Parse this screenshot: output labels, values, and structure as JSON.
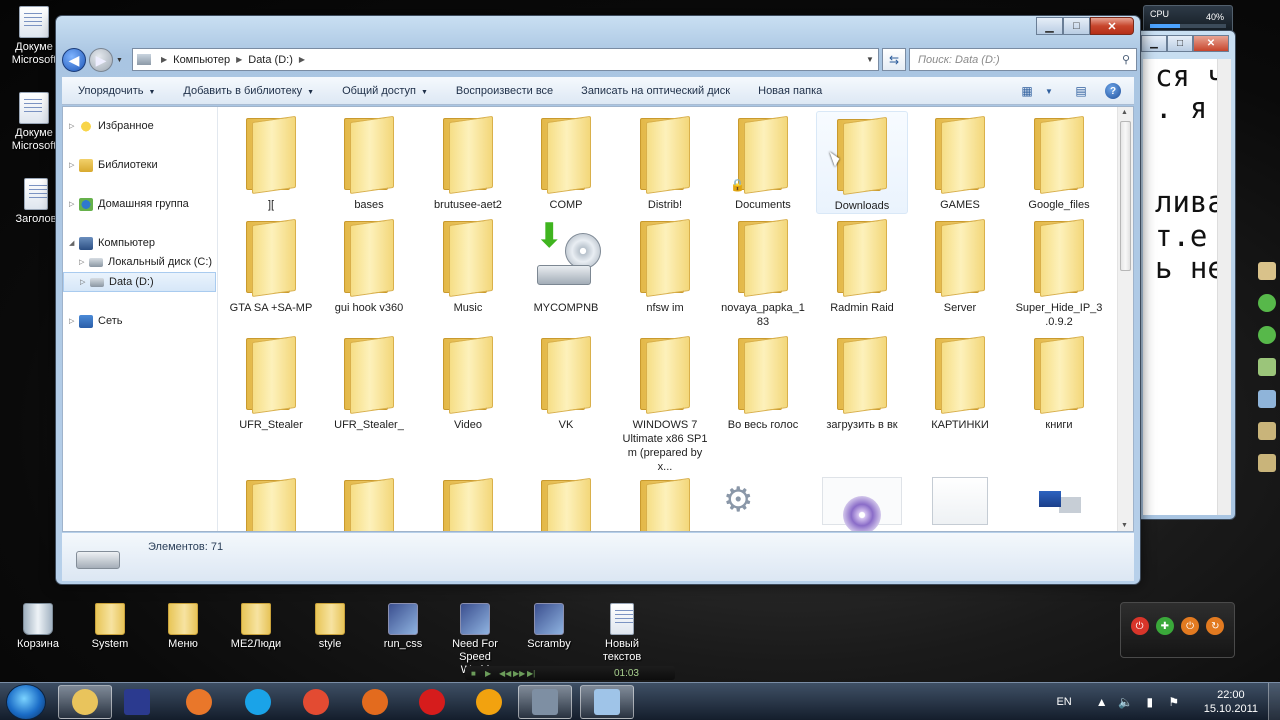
{
  "desktop": {
    "icons_left": [
      {
        "label": "Докуме Microsoft",
        "icon": "word-doc-icon"
      },
      {
        "label": "Докуме Microsoft",
        "icon": "word-doc-icon"
      },
      {
        "label": "Заголов",
        "icon": "text-doc-icon"
      }
    ],
    "icons_bottom": [
      {
        "label": "Корзина",
        "icon": "recycle-bin-icon"
      },
      {
        "label": "System",
        "icon": "folder-icon"
      },
      {
        "label": "Меню",
        "icon": "folder-icon"
      },
      {
        "label": "ME2Люди",
        "icon": "folder-icon"
      },
      {
        "label": "style",
        "icon": "folder-icon"
      },
      {
        "label": "run_css",
        "icon": "cs-shortcut-icon"
      },
      {
        "label": "Need For Speed World",
        "icon": "nfs-shortcut-icon"
      },
      {
        "label": "Scramby",
        "icon": "scramby-shortcut-icon"
      },
      {
        "label": "Новый текстов",
        "icon": "text-doc-icon"
      }
    ]
  },
  "cpu_gadget": {
    "label": "CPU",
    "value": "40%",
    "percent": 40
  },
  "explorer": {
    "address": {
      "segments": [
        "Компьютер",
        "Data (D:)"
      ]
    },
    "search": {
      "placeholder": "Поиск: Data (D:)"
    },
    "toolbar": [
      {
        "label": "Упорядочить",
        "dropdown": true
      },
      {
        "label": "Добавить в библиотеку",
        "dropdown": true
      },
      {
        "label": "Общий доступ",
        "dropdown": true
      },
      {
        "label": "Воспроизвести все",
        "dropdown": false
      },
      {
        "label": "Записать на оптический диск",
        "dropdown": false
      },
      {
        "label": "Новая папка",
        "dropdown": false
      }
    ],
    "nav": [
      {
        "label": "Избранное",
        "icon": "star-icon"
      },
      {
        "label": "Библиотеки",
        "icon": "library-icon"
      },
      {
        "label": "Домашняя группа",
        "icon": "homegroup-icon"
      },
      {
        "label": "Компьютер",
        "icon": "computer-icon"
      },
      {
        "label": "Локальный диск (C:)",
        "icon": "drive-icon"
      },
      {
        "label": "Data (D:)",
        "icon": "drive-icon",
        "selected": true
      },
      {
        "label": "Сеть",
        "icon": "network-icon"
      }
    ],
    "files": [
      {
        "name": "][",
        "type": "folder"
      },
      {
        "name": "bases",
        "type": "folder"
      },
      {
        "name": "brutusee-aet2",
        "type": "folder"
      },
      {
        "name": "COMP",
        "type": "folder"
      },
      {
        "name": "Distrib!",
        "type": "folder"
      },
      {
        "name": "Documents",
        "type": "folder",
        "locked": true
      },
      {
        "name": "Downloads",
        "type": "folder",
        "hover": true
      },
      {
        "name": "GAMES",
        "type": "folder"
      },
      {
        "name": "Google_files",
        "type": "folder"
      },
      {
        "name": "GTA SA +SA-MP",
        "type": "folder"
      },
      {
        "name": "gui hook v360",
        "type": "folder"
      },
      {
        "name": "Music",
        "type": "folder"
      },
      {
        "name": "MYCOMPNB",
        "type": "drive"
      },
      {
        "name": "nfsw im",
        "type": "folder"
      },
      {
        "name": "novaya_papka_1 83",
        "type": "folder"
      },
      {
        "name": "Radmin Raid",
        "type": "folder"
      },
      {
        "name": "Server",
        "type": "folder"
      },
      {
        "name": "Super_Hide_IP_3 .0.9.2",
        "type": "folder"
      },
      {
        "name": "UFR_Stealer",
        "type": "folder"
      },
      {
        "name": "UFR_Stealer_",
        "type": "folder"
      },
      {
        "name": "Video",
        "type": "folder"
      },
      {
        "name": "VK",
        "type": "folder"
      },
      {
        "name": "WINDOWS 7 Ultimate x86 SP1 m (prepared by x...",
        "type": "folder"
      },
      {
        "name": "Во весь голос",
        "type": "folder"
      },
      {
        "name": "загрузить в вк",
        "type": "folder"
      },
      {
        "name": "КАРТИНКИ",
        "type": "folder"
      },
      {
        "name": "книги",
        "type": "folder"
      },
      {
        "name": "",
        "type": "folder"
      },
      {
        "name": "",
        "type": "folder"
      },
      {
        "name": "",
        "type": "folder"
      },
      {
        "name": "",
        "type": "folder"
      },
      {
        "name": "",
        "type": "folder"
      },
      {
        "name": "",
        "type": "gear"
      },
      {
        "name": "",
        "type": "disc"
      },
      {
        "name": "",
        "type": "doc"
      },
      {
        "name": "",
        "type": "app"
      }
    ],
    "status": {
      "text": "Элементов: 71"
    }
  },
  "bg_window": {
    "lines": [
      "ся ч",
      ". я",
      "",
      "лива",
      "т.е",
      "ь не"
    ]
  },
  "player": {
    "time": "01:03"
  },
  "taskbar": {
    "buttons": [
      "explorer-icon",
      "floppy-icon",
      "mail-icon",
      "skype-icon",
      "chrome-icon",
      "firefox-icon",
      "opera-icon",
      "aimp-icon",
      "media-icon",
      "notepad-icon"
    ],
    "lang": "EN",
    "time": "22:00",
    "date": "15.10.2011"
  },
  "colors": {
    "accent": "#1c56b8",
    "folder": "#f2d279",
    "close": "#c7452c"
  }
}
